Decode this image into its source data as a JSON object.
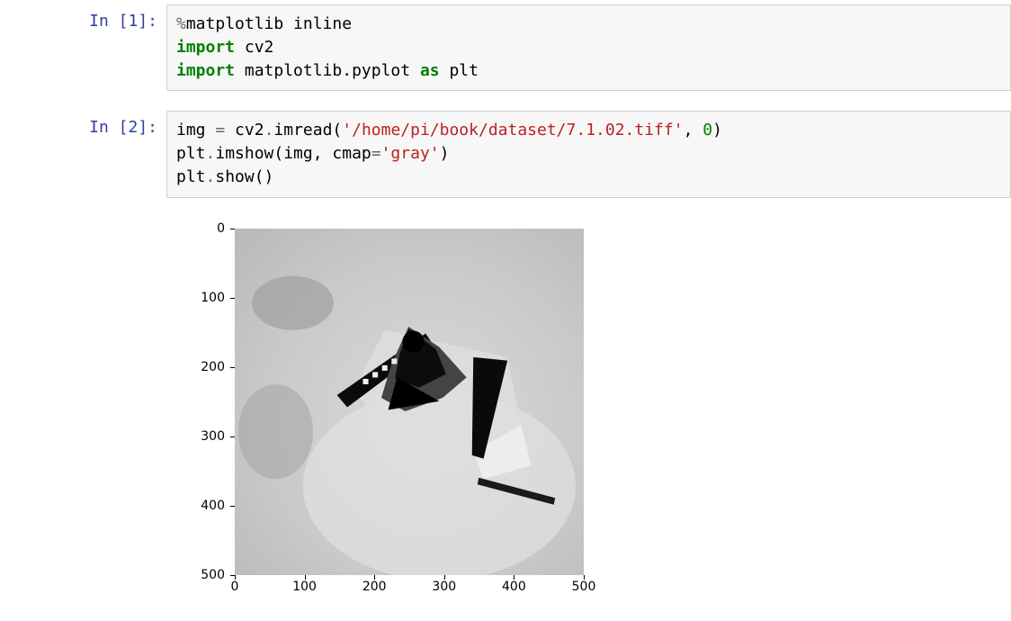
{
  "cells": [
    {
      "prompt": "In [1]:",
      "code": {
        "line1_magic": "%",
        "line1_text": "matplotlib inline",
        "line2_kw": "import",
        "line2_mod": " cv2",
        "line3_kw": "import",
        "line3_mod": " matplotlib.pyplot ",
        "line3_as": "as",
        "line3_alias": " plt"
      }
    },
    {
      "prompt": "In [2]:",
      "code": {
        "line1_pre": "img ",
        "line1_eq": "=",
        "line1_call1": " cv2",
        "line1_dot1": ".",
        "line1_call2": "imread(",
        "line1_str": "'/home/pi/book/dataset/7.1.02.tiff'",
        "line1_comma": ", ",
        "line1_num": "0",
        "line1_close": ")",
        "line2_pre": "plt",
        "line2_dot": ".",
        "line2_call": "imshow(img, cmap",
        "line2_eq": "=",
        "line2_str": "'gray'",
        "line2_close": ")",
        "line3_pre": "plt",
        "line3_dot": ".",
        "line3_call": "show()"
      }
    }
  ],
  "chart_data": {
    "type": "image",
    "description": "Grayscale aerial image displayed via matplotlib imshow",
    "x_ticks": [
      "0",
      "100",
      "200",
      "300",
      "400",
      "500"
    ],
    "y_ticks": [
      "0",
      "100",
      "200",
      "300",
      "400",
      "500"
    ],
    "xlim": [
      0,
      500
    ],
    "ylim": [
      500,
      0
    ],
    "cmap": "gray"
  }
}
